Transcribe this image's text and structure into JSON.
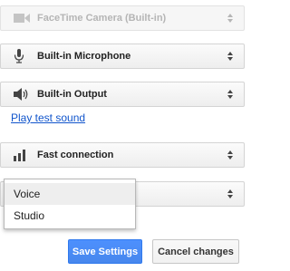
{
  "camera": {
    "label": "FaceTime Camera (Built-in)",
    "icon": "video-camera-icon",
    "disabled": true
  },
  "microphone": {
    "label": "Built-in Microphone",
    "icon": "microphone-icon"
  },
  "output": {
    "label": "Built-in Output",
    "icon": "speaker-icon"
  },
  "test_sound_link": "Play test sound",
  "bandwidth": {
    "label": "Fast connection",
    "icon": "signal-bars-icon"
  },
  "audio_mode_menu": {
    "options": [
      "Voice",
      "Studio"
    ],
    "highlighted": "Voice"
  },
  "buttons": {
    "save": "Save Settings",
    "cancel": "Cancel changes"
  },
  "colors": {
    "primary_button": "#4d90fe",
    "link": "#1155cc"
  }
}
